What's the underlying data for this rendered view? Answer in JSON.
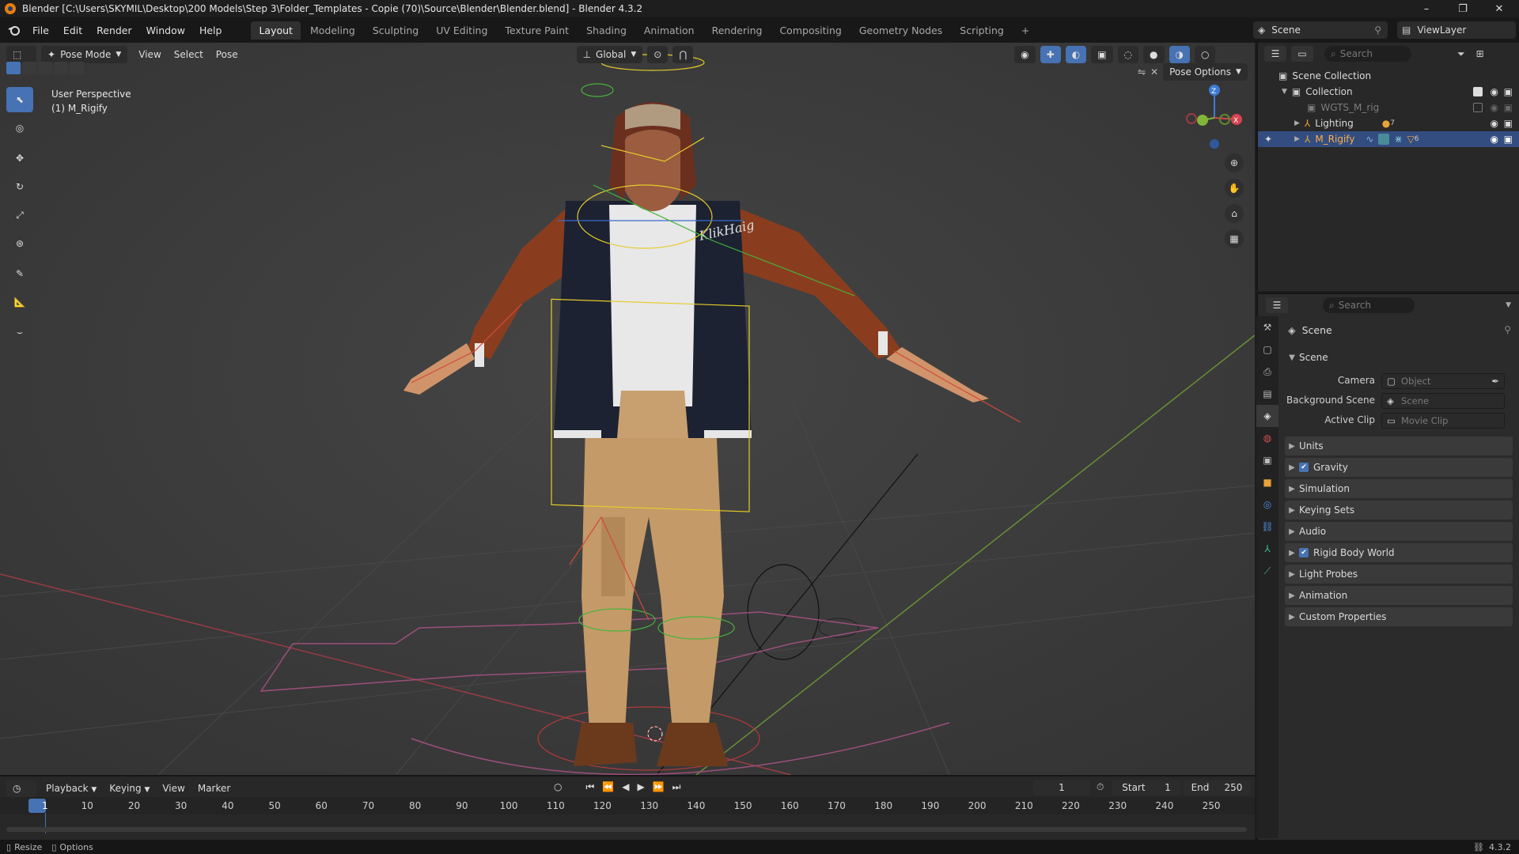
{
  "titlebar": {
    "title": "Blender [C:\\Users\\SKYMIL\\Desktop\\200 Models\\Step 3\\Folder_Templates - Copie (70)\\Source\\Blender\\Blender.blend] - Blender 4.3.2",
    "minimize": "–",
    "maximize": "❐",
    "close": "✕"
  },
  "menubar": {
    "menus": [
      "File",
      "Edit",
      "Render",
      "Window",
      "Help"
    ],
    "workspaces": [
      "Layout",
      "Modeling",
      "Sculpting",
      "UV Editing",
      "Texture Paint",
      "Shading",
      "Animation",
      "Rendering",
      "Compositing",
      "Geometry Nodes",
      "Scripting"
    ],
    "active_workspace": "Layout",
    "add_workspace": "+",
    "scene_name": "Scene",
    "view_layer": "ViewLayer"
  },
  "viewport": {
    "mode": "Pose Mode",
    "menus": [
      "View",
      "Select",
      "Pose"
    ],
    "orientation": "Global",
    "pose_options": "Pose Options",
    "perspective_label": "User Perspective",
    "object_label": "(1) M_Rigify",
    "gizmo_axes": {
      "z": "Z",
      "x": "X"
    },
    "brand_text": "KlikHaig"
  },
  "outliner": {
    "search_placeholder": "Search",
    "root": "Scene Collection",
    "items": [
      {
        "label": "Collection",
        "indent": 1
      },
      {
        "label": "WGTS_M_rig",
        "indent": 2
      },
      {
        "label": "Lighting",
        "indent": 2,
        "badge": "7"
      },
      {
        "label": "M_Rigify",
        "indent": 2,
        "badge": "6",
        "selected": true
      }
    ]
  },
  "properties": {
    "search_placeholder": "Search",
    "context": "Scene",
    "scene_panel": "Scene",
    "fields": [
      {
        "label": "Camera",
        "placeholder": "Object"
      },
      {
        "label": "Background Scene",
        "placeholder": "Scene"
      },
      {
        "label": "Active Clip",
        "placeholder": "Movie Clip"
      }
    ],
    "panels": [
      {
        "label": "Units",
        "checkbox": false
      },
      {
        "label": "Gravity",
        "checkbox": true
      },
      {
        "label": "Simulation",
        "checkbox": false
      },
      {
        "label": "Keying Sets",
        "checkbox": false
      },
      {
        "label": "Audio",
        "checkbox": false
      },
      {
        "label": "Rigid Body World",
        "checkbox": true
      },
      {
        "label": "Light Probes",
        "checkbox": false
      },
      {
        "label": "Animation",
        "checkbox": false
      },
      {
        "label": "Custom Properties",
        "checkbox": false
      }
    ]
  },
  "timeline": {
    "menus": [
      "Playback",
      "Keying",
      "View",
      "Marker"
    ],
    "current_frame": "1",
    "start_label": "Start",
    "start_value": "1",
    "end_label": "End",
    "end_value": "250",
    "ruler": [
      "1",
      "10",
      "20",
      "30",
      "40",
      "50",
      "60",
      "70",
      "80",
      "90",
      "100",
      "110",
      "120",
      "130",
      "140",
      "150",
      "160",
      "170",
      "180",
      "190",
      "200",
      "210",
      "220",
      "230",
      "240",
      "250"
    ]
  },
  "statusbar": {
    "left": [
      "Resize",
      "Options"
    ],
    "version": "4.3.2"
  },
  "colors": {
    "accent": "#4772b3",
    "blender_orange": "#e87d0d",
    "x_axis": "#d7434f",
    "y_axis": "#82b63a",
    "z_axis": "#3d7ad6"
  }
}
